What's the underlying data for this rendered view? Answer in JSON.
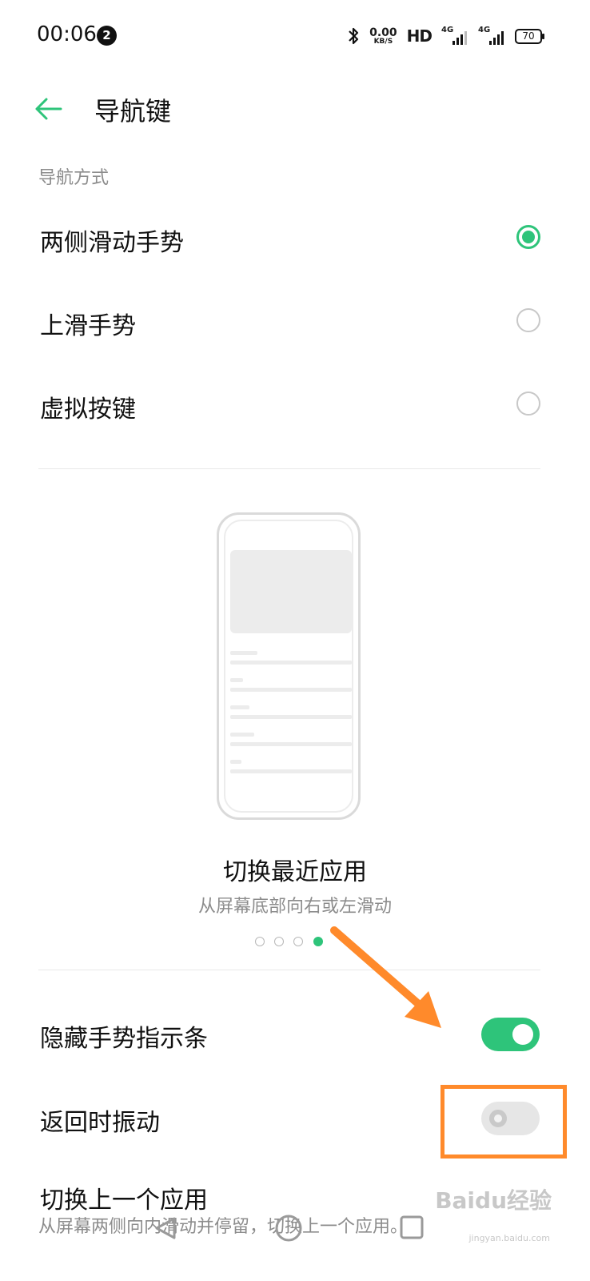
{
  "status_bar": {
    "time": "00:06",
    "notification_count": "2",
    "net_speed_value": "0.00",
    "net_speed_unit": "KB/S",
    "hd_label": "HD",
    "signal1_label": "4G",
    "signal2_label": "4G",
    "battery": "70"
  },
  "header": {
    "title": "导航键"
  },
  "nav_mode": {
    "section_title": "导航方式",
    "options": [
      {
        "label": "两侧滑动手势",
        "selected": true
      },
      {
        "label": "上滑手势",
        "selected": false
      },
      {
        "label": "虚拟按键",
        "selected": false
      }
    ]
  },
  "guide": {
    "title": "切换最近应用",
    "subtitle": "从屏幕底部向右或左滑动",
    "page_count": 4,
    "active_page": 4
  },
  "settings": {
    "hide_gesture_bar": {
      "label": "隐藏手势指示条",
      "enabled": true
    },
    "vibrate_on_back": {
      "label": "返回时振动",
      "enabled": false
    },
    "switch_prev_app": {
      "title": "切换上一个应用",
      "description": "从屏幕两侧向内滑动并停留，切换上一个应用。"
    }
  },
  "watermark": {
    "text": "Baidu经验",
    "url": "jingyan.baidu.com"
  },
  "colors": {
    "accent": "#2ec47a",
    "annotation": "#ff8a2b"
  },
  "icons": [
    "bluetooth-icon",
    "back-arrow-icon",
    "signal-icon",
    "battery-icon",
    "nav-back-icon",
    "nav-home-icon",
    "nav-recent-icon"
  ]
}
